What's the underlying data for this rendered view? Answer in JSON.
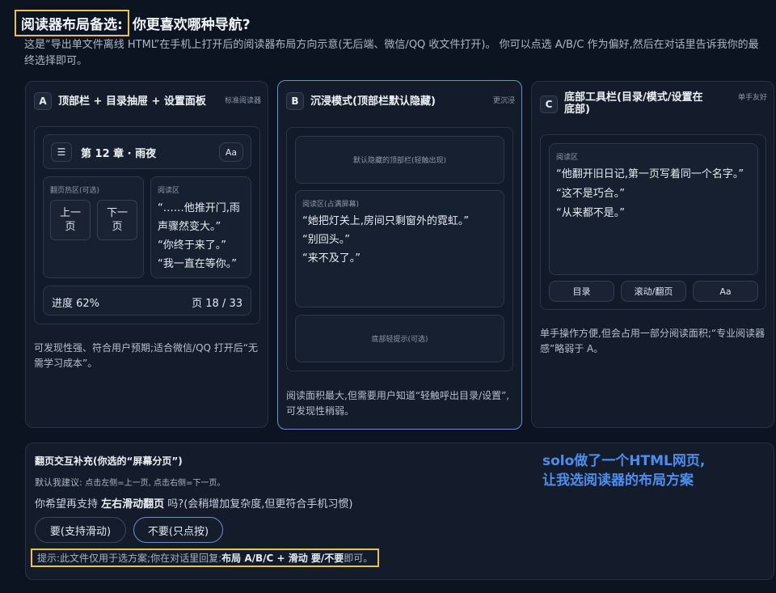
{
  "header": {
    "title_highlight": "阅读器布局备选:",
    "title_rest": "你更喜欢哪种导航?",
    "intro": "这是“导出单文件离线 HTML”在手机上打开后的阅读器布局方向示意(无后端、微信/QQ 收文件打开)。 你可以点选 A/B/C 作为偏好,然后在对话里告诉我你的最终选择即可。"
  },
  "cards": {
    "a": {
      "letter": "A",
      "title": "顶部栏 + 目录抽屉 + 设置面板",
      "tag": "标准阅读器",
      "chapter": "第 12 章 · 雨夜",
      "font_button": "Aa",
      "menu_glyph": "☰",
      "flip_zone_label": "翻页热区(可选)",
      "prev_page": "上一页",
      "next_page": "下一页",
      "read_zone_label": "阅读区",
      "lines": [
        "“……他推开门,雨声骤然变大。”",
        "“你终于来了。”",
        "“我一直在等你。”"
      ],
      "progress_label": "进度 62%",
      "page_label": "页 18 / 33",
      "description": "可发现性强、符合用户预期;适合微信/QQ 打开后“无需学习成本”。"
    },
    "b": {
      "letter": "B",
      "title": "沉浸模式(顶部栏默认隐藏)",
      "tag": "更沉浸",
      "hidden_bar": "默认隐藏的顶部栏(轻触出现)",
      "read_zone_label": "阅读区(占满屏幕)",
      "lines": [
        "“她把灯关上,房间只剩窗外的霓虹。”",
        "“别回头。”",
        "“来不及了。”"
      ],
      "bottom_hint": "底部轻提示(可选)",
      "description": "阅读面积最大,但需要用户知道“轻触呼出目录/设置”,可发现性稍弱。"
    },
    "c": {
      "letter": "C",
      "title": "底部工具栏(目录/模式/设置在底部)",
      "tag": "单手友好",
      "read_zone_label": "阅读区",
      "lines": [
        "“他翻开旧日记,第一页写着同一个名字。”",
        "“这不是巧合。”",
        "“从来都不是。”"
      ],
      "toolbar": [
        "目录",
        "滚动/翻页",
        "Aa"
      ],
      "description": "单手操作方便,但会占用一部分阅读面积;“专业阅读器感”略弱于 A。"
    }
  },
  "bottom": {
    "title": "翻页交互补充(你选的“屏幕分页”)",
    "default_label": "默认我建议:",
    "default_text": "点击左侧=上一页, 点击右侧=下一页。",
    "question_pre": "你希望再支持 ",
    "question_bold": "左右滑动翻页",
    "question_post": " 吗?(会稍增加复杂度,但更符合手机习惯)",
    "option_yes": "要(支持滑动)",
    "option_no": "不要(只点按)",
    "hint_pre": "提示:此文件仅用于选方案;你在对话里回复:",
    "hint_bold": "布局 A/B/C + 滑动 要/不要",
    "hint_post": " 即可。",
    "annotation_line1": "solo做了一个HTML网页,",
    "annotation_line2": "让我选阅读器的布局方案"
  }
}
